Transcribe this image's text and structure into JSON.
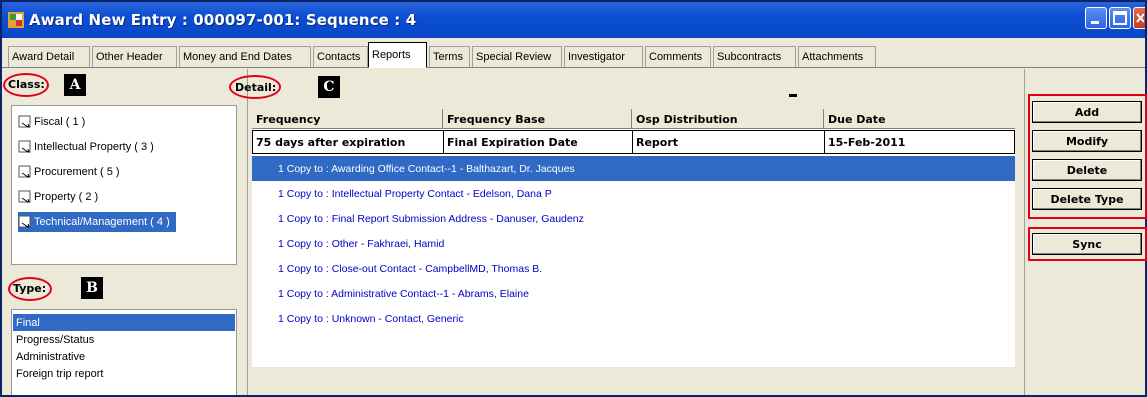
{
  "window": {
    "title": "Award New Entry : 000097-001: Sequence : 4"
  },
  "tabs": [
    {
      "label": "Award Detail"
    },
    {
      "label": "Other Header"
    },
    {
      "label": "Money and End Dates"
    },
    {
      "label": "Contacts"
    },
    {
      "label": "Reports",
      "active": true
    },
    {
      "label": "Terms"
    },
    {
      "label": "Special Review"
    },
    {
      "label": "Investigator"
    },
    {
      "label": "Comments"
    },
    {
      "label": "Subcontracts"
    },
    {
      "label": "Attachments"
    }
  ],
  "class_section": {
    "label": "Class:",
    "badge": "A",
    "items": [
      {
        "label": "Fiscal ( 1 )"
      },
      {
        "label": "Intellectual Property ( 3 )"
      },
      {
        "label": "Procurement ( 5 )"
      },
      {
        "label": "Property ( 2 )"
      },
      {
        "label": "Technical/Management ( 4 )",
        "selected": true
      }
    ]
  },
  "type_section": {
    "label": "Type:",
    "badge": "B",
    "items": [
      {
        "label": "Final",
        "selected": true
      },
      {
        "label": "Progress/Status"
      },
      {
        "label": "Administrative"
      },
      {
        "label": "Foreign trip report"
      }
    ]
  },
  "detail_section": {
    "label": "Detail:",
    "badge": "C",
    "columns": [
      "Frequency",
      "Frequency Base",
      "Osp Distribution",
      "Due Date"
    ],
    "row": [
      "75 days after expiration",
      "Final Expiration Date",
      "Report",
      "15-Feb-2011"
    ],
    "copies": [
      {
        "text": "1 Copy to : Awarding Office Contact--1 - Balthazart, Dr. Jacques",
        "selected": true
      },
      {
        "text": "1 Copy to : Intellectual Property Contact - Edelson,  Dana P"
      },
      {
        "text": "1 Copy to : Final Report Submission Address - Danuser,  Gaudenz"
      },
      {
        "text": "1 Copy to : Other - Fakhraei,  Hamid"
      },
      {
        "text": "1 Copy to : Close-out Contact - CampbellMD,  Thomas B."
      },
      {
        "text": "1 Copy to : Administrative Contact--1 - Abrams,  Elaine"
      },
      {
        "text": "1 Copy to : Unknown - Contact,  Generic"
      }
    ]
  },
  "actions": {
    "add": "Add",
    "modify": "Modify",
    "delete": "Delete",
    "delete_type": "Delete Type",
    "sync": "Sync"
  },
  "colors": {
    "selection": "#316ac5",
    "annotation_red": "#e2001a",
    "link_blue": "#0000c8"
  }
}
